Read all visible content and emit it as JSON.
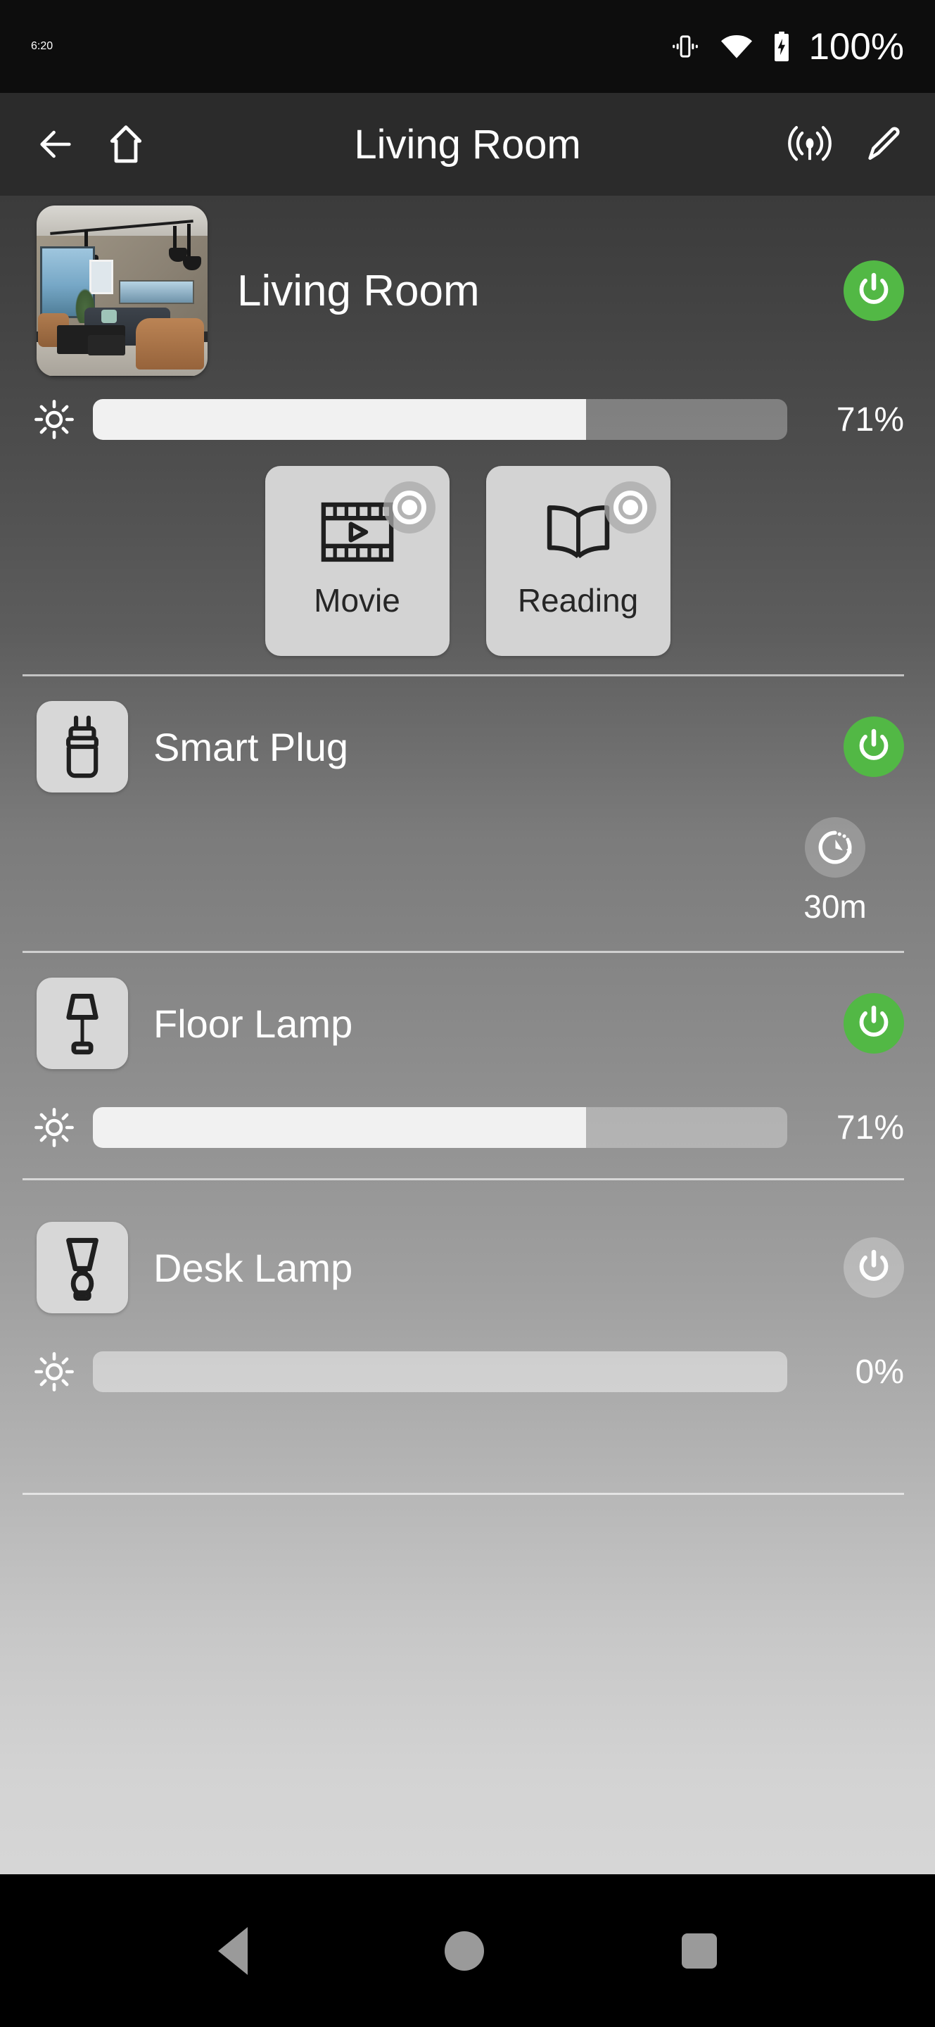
{
  "status_bar": {
    "clock": "6:20",
    "battery_text": "100%",
    "icons": [
      "vibrate-icon",
      "wifi-icon",
      "battery-charging-icon"
    ]
  },
  "app_bar": {
    "title": "Living Room",
    "back_icon": "back-arrow-icon",
    "home_icon": "home-icon",
    "broadcast_icon": "broadcast-icon",
    "edit_icon": "pencil-edit-icon"
  },
  "room": {
    "name": "Living Room",
    "thumbnail_icon": "room-photo-thumbnail",
    "power_state": "on",
    "power_icon": "power-icon",
    "brightness": {
      "icon": "brightness-sun-icon",
      "value": 71,
      "label": "71%"
    }
  },
  "scenes": [
    {
      "label": "Movie",
      "icon": "film-strip-icon",
      "radio_icon": "radio-selected-icon",
      "selected": false
    },
    {
      "label": "Reading",
      "icon": "open-book-icon",
      "radio_icon": "radio-selected-icon",
      "selected": false
    }
  ],
  "devices": [
    {
      "name": "Smart Plug",
      "icon": "smart-plug-icon",
      "power_state": "on",
      "power_icon": "power-icon",
      "timer": {
        "icon": "timer-icon",
        "label": "30m"
      }
    },
    {
      "name": "Floor Lamp",
      "icon": "floor-lamp-icon",
      "power_state": "on",
      "power_icon": "power-icon",
      "brightness": {
        "icon": "brightness-sun-icon",
        "value": 71,
        "label": "71%"
      }
    },
    {
      "name": "Desk Lamp",
      "icon": "desk-lamp-icon",
      "power_state": "off",
      "power_icon": "power-icon",
      "brightness": {
        "icon": "brightness-sun-icon",
        "value": 0,
        "label": "0%"
      }
    }
  ],
  "nav_bar": {
    "back_icon": "nav-back-icon",
    "home_icon": "nav-home-icon",
    "recents_icon": "nav-recents-icon"
  },
  "colors": {
    "accent_on": "#52b845",
    "status_bar_bg": "#0d0d0d",
    "app_bar_bg": "#2b2b2b",
    "slider_fill": "#f1f1f1",
    "card_bg": "#d3d3d3"
  }
}
